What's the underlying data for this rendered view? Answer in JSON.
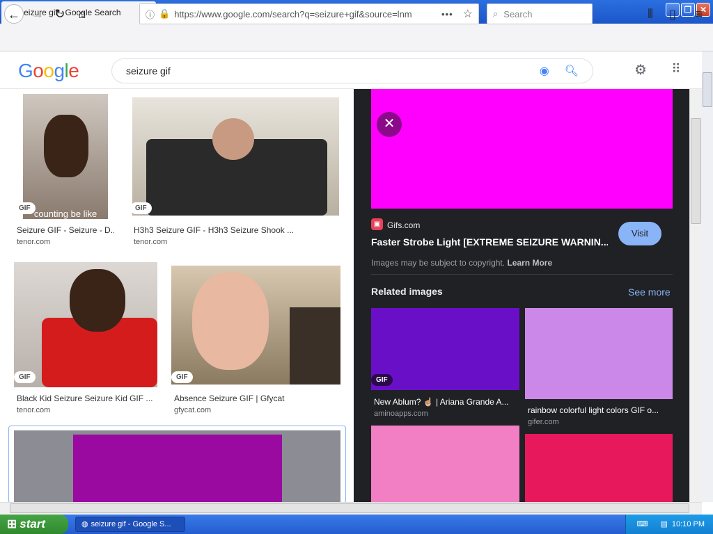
{
  "browser": {
    "tab_title": "seizure gif - Google Search",
    "tab_icon": "G",
    "url": "https://www.google.com/search?q=seizure+gif&source=lnm",
    "search_placeholder": "Search"
  },
  "google": {
    "logo_text": "Google",
    "query": "seizure gif"
  },
  "results": [
    {
      "title": "Seizure GIF - Seizure - D...",
      "source": "tenor.com",
      "badge": "GIF",
      "overlay": "counting be like"
    },
    {
      "title": "H3h3 Seizure GIF - H3h3 Seizure Shook ...",
      "source": "tenor.com",
      "badge": "GIF"
    },
    {
      "title": "Black Kid Seizure Seizure Kid GIF ...",
      "source": "tenor.com",
      "badge": "GIF"
    },
    {
      "title": "Absence Seizure GIF | Gfycat",
      "source": "gfycat.com",
      "badge": "GIF"
    }
  ],
  "panel": {
    "source_name": "Gifs.com",
    "title": "Faster Strobe Light [EXTREME SEIZURE WARNIN...",
    "visit_label": "Visit",
    "copyright_text": "Images may be subject to copyright.",
    "learn_more": "Learn More",
    "related_heading": "Related images",
    "see_more": "See more",
    "related": [
      {
        "title": "New Ablum? ☝🏼 | Ariana Grande A...",
        "source": "aminoapps.com",
        "badge": "GIF",
        "color": "#6a0fc8"
      },
      {
        "title": "rainbow colorful light colors GIF o...",
        "source": "gifer.com",
        "color": "#cc88e8"
      },
      {
        "color": "#f27ec4"
      },
      {
        "color": "#e8185c"
      }
    ],
    "main_color": "#ff00ff"
  },
  "taskbar": {
    "start_label": "start",
    "task_label": "seizure gif - Google S...",
    "clock": "10:10 PM"
  }
}
